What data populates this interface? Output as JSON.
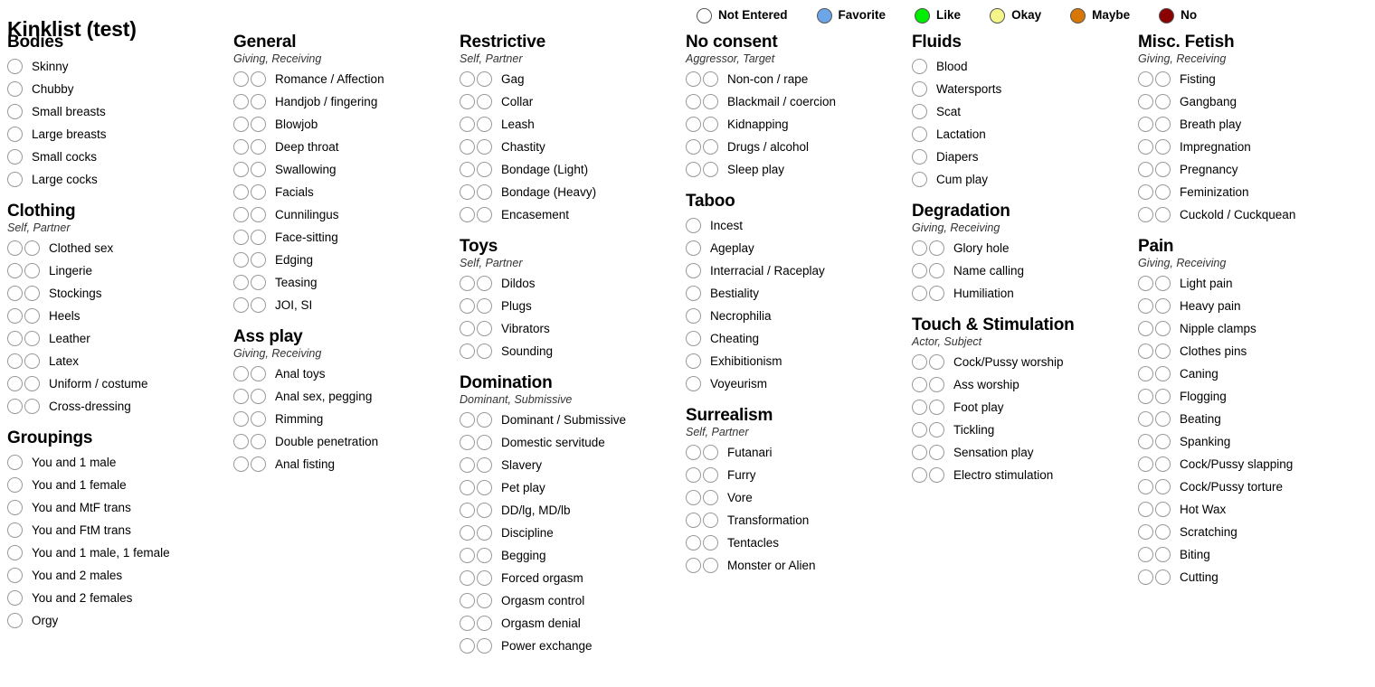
{
  "title": "Kinklist (test)",
  "legend": {
    "items": [
      {
        "label": "Not Entered",
        "color": "#ffffff",
        "name": "not-entered"
      },
      {
        "label": "Favorite",
        "color": "#6ca6e8",
        "name": "favorite"
      },
      {
        "label": "Like",
        "color": "#00ee00",
        "name": "like"
      },
      {
        "label": "Okay",
        "color": "#f5f58a",
        "name": "okay"
      },
      {
        "label": "Maybe",
        "color": "#d97706",
        "name": "maybe"
      },
      {
        "label": "No",
        "color": "#8b0000",
        "name": "no"
      }
    ]
  },
  "columns": [
    {
      "categories": [
        {
          "name": "Bodies",
          "subtitle": "",
          "choices": 1,
          "kinks": [
            "Skinny",
            "Chubby",
            "Small breasts",
            "Large breasts",
            "Small cocks",
            "Large cocks"
          ]
        },
        {
          "name": "Clothing",
          "subtitle": "Self, Partner",
          "choices": 2,
          "kinks": [
            "Clothed sex",
            "Lingerie",
            "Stockings",
            "Heels",
            "Leather",
            "Latex",
            "Uniform / costume",
            "Cross-dressing"
          ]
        },
        {
          "name": "Groupings",
          "subtitle": "",
          "choices": 1,
          "kinks": [
            "You and 1 male",
            "You and 1 female",
            "You and MtF trans",
            "You and FtM trans",
            "You and 1 male, 1 female",
            "You and 2 males",
            "You and 2 females",
            "Orgy"
          ]
        }
      ]
    },
    {
      "categories": [
        {
          "name": "General",
          "subtitle": "Giving, Receiving",
          "choices": 2,
          "kinks": [
            "Romance / Affection",
            "Handjob / fingering",
            "Blowjob",
            "Deep throat",
            "Swallowing",
            "Facials",
            "Cunnilingus",
            "Face-sitting",
            "Edging",
            "Teasing",
            "JOI, SI"
          ]
        },
        {
          "name": "Ass play",
          "subtitle": "Giving, Receiving",
          "choices": 2,
          "kinks": [
            "Anal toys",
            "Anal sex, pegging",
            "Rimming",
            "Double penetration",
            "Anal fisting"
          ]
        }
      ]
    },
    {
      "categories": [
        {
          "name": "Restrictive",
          "subtitle": "Self, Partner",
          "choices": 2,
          "kinks": [
            "Gag",
            "Collar",
            "Leash",
            "Chastity",
            "Bondage (Light)",
            "Bondage (Heavy)",
            "Encasement"
          ]
        },
        {
          "name": "Toys",
          "subtitle": "Self, Partner",
          "choices": 2,
          "kinks": [
            "Dildos",
            "Plugs",
            "Vibrators",
            "Sounding"
          ]
        },
        {
          "name": "Domination",
          "subtitle": "Dominant, Submissive",
          "choices": 2,
          "kinks": [
            "Dominant / Submissive",
            "Domestic servitude",
            "Slavery",
            "Pet play",
            "DD/lg, MD/lb",
            "Discipline",
            "Begging",
            "Forced orgasm",
            "Orgasm control",
            "Orgasm denial",
            "Power exchange"
          ]
        }
      ]
    },
    {
      "categories": [
        {
          "name": "No consent",
          "subtitle": "Aggressor, Target",
          "choices": 2,
          "kinks": [
            "Non-con / rape",
            "Blackmail / coercion",
            "Kidnapping",
            "Drugs / alcohol",
            "Sleep play"
          ]
        },
        {
          "name": "Taboo",
          "subtitle": "",
          "choices": 1,
          "kinks": [
            "Incest",
            "Ageplay",
            "Interracial / Raceplay",
            "Bestiality",
            "Necrophilia",
            "Cheating",
            "Exhibitionism",
            "Voyeurism"
          ]
        },
        {
          "name": "Surrealism",
          "subtitle": "Self, Partner",
          "choices": 2,
          "kinks": [
            "Futanari",
            "Furry",
            "Vore",
            "Transformation",
            "Tentacles",
            "Monster or Alien"
          ]
        }
      ]
    },
    {
      "categories": [
        {
          "name": "Fluids",
          "subtitle": "",
          "choices": 1,
          "kinks": [
            "Blood",
            "Watersports",
            "Scat",
            "Lactation",
            "Diapers",
            "Cum play"
          ]
        },
        {
          "name": "Degradation",
          "subtitle": "Giving, Receiving",
          "choices": 2,
          "kinks": [
            "Glory hole",
            "Name calling",
            "Humiliation"
          ]
        },
        {
          "name": "Touch & Stimulation",
          "subtitle": "Actor, Subject",
          "choices": 2,
          "kinks": [
            "Cock/Pussy worship",
            "Ass worship",
            "Foot play",
            "Tickling",
            "Sensation play",
            "Electro stimulation"
          ]
        }
      ]
    },
    {
      "categories": [
        {
          "name": "Misc. Fetish",
          "subtitle": "Giving, Receiving",
          "choices": 2,
          "kinks": [
            "Fisting",
            "Gangbang",
            "Breath play",
            "Impregnation",
            "Pregnancy",
            "Feminization",
            "Cuckold / Cuckquean"
          ]
        },
        {
          "name": "Pain",
          "subtitle": "Giving, Receiving",
          "choices": 2,
          "kinks": [
            "Light pain",
            "Heavy pain",
            "Nipple clamps",
            "Clothes pins",
            "Caning",
            "Flogging",
            "Beating",
            "Spanking",
            "Cock/Pussy slapping",
            "Cock/Pussy torture",
            "Hot Wax",
            "Scratching",
            "Biting",
            "Cutting"
          ]
        }
      ]
    }
  ]
}
